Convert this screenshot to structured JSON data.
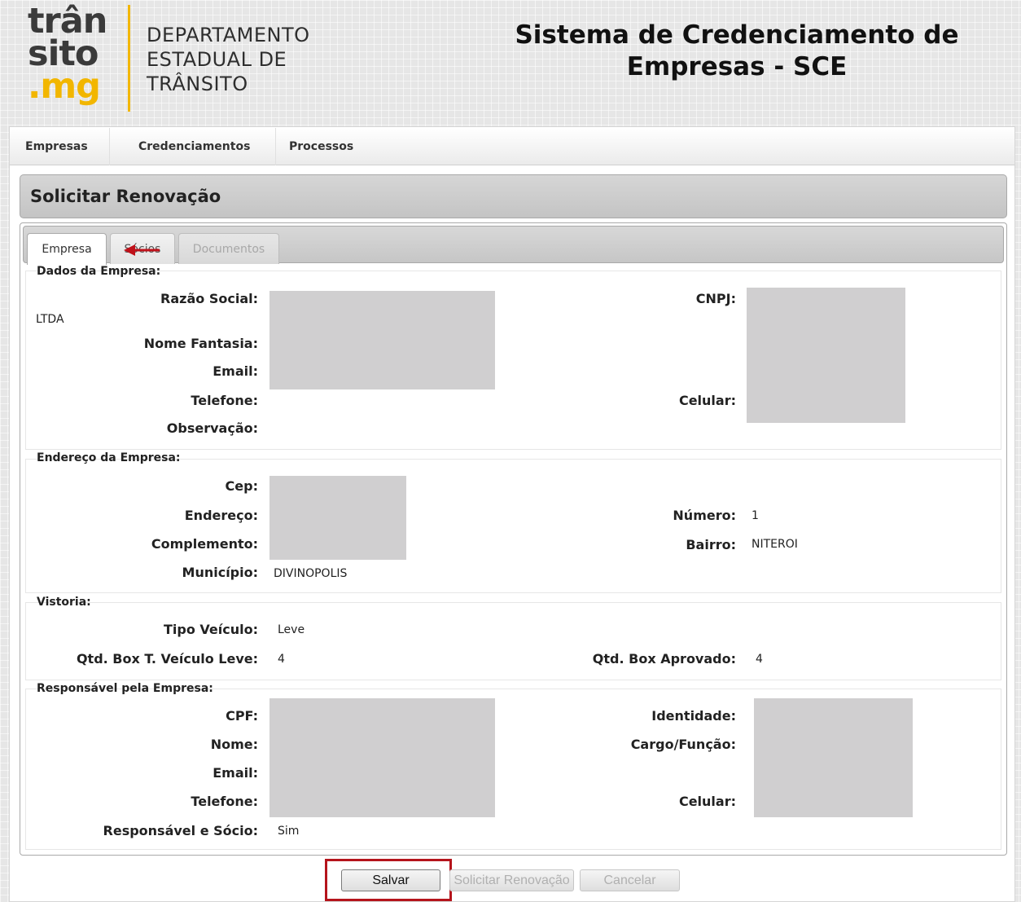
{
  "header": {
    "logo": {
      "line1": "trân",
      "line2": "sito",
      "line3": ".mg"
    },
    "department": [
      "DEPARTAMENTO",
      "ESTADUAL DE",
      "TRÂNSITO"
    ],
    "system_title": [
      "Sistema de Credenciamento de",
      "Empresas - SCE"
    ]
  },
  "menu": {
    "items": [
      "Empresas",
      "Credenciamentos",
      "Processos"
    ]
  },
  "page": {
    "title": "Solicitar Renovação",
    "tabs": [
      "Empresa",
      "Sócios",
      "Documentos"
    ]
  },
  "dados_empresa": {
    "title": "Dados da Empresa:",
    "labels": {
      "razao_social": "Razão Social:",
      "nome_fantasia": "Nome Fantasia:",
      "email": "Email:",
      "telefone": "Telefone:",
      "observacao": "Observação:",
      "cnpj": "CNPJ:",
      "celular": "Celular:"
    },
    "values": {
      "razao_social_suffix": "LTDA"
    }
  },
  "endereco": {
    "title": "Endereço da Empresa:",
    "labels": {
      "cep": "Cep:",
      "endereco": "Endereço:",
      "complemento": "Complemento:",
      "municipio": "Município:",
      "numero": "Número:",
      "bairro": "Bairro:"
    },
    "values": {
      "municipio": "DIVINOPOLIS",
      "numero": "1",
      "bairro": "NITEROI"
    }
  },
  "vistoria": {
    "title": "Vistoria:",
    "labels": {
      "tipo_veiculo": "Tipo Veículo:",
      "qtd_box_leve": "Qtd. Box T. Veículo Leve:",
      "qtd_box_aprovado": "Qtd. Box Aprovado:"
    },
    "values": {
      "tipo_veiculo": "Leve",
      "qtd_box_leve": "4",
      "qtd_box_aprovado": "4"
    }
  },
  "responsavel": {
    "title": "Responsável pela Empresa:",
    "labels": {
      "cpf": "CPF:",
      "nome": "Nome:",
      "email": "Email:",
      "telefone": "Telefone:",
      "responsavel_socio": "Responsável e Sócio:",
      "identidade": "Identidade:",
      "cargo": "Cargo/Função:",
      "celular": "Celular:"
    },
    "values": {
      "responsavel_socio": "Sim"
    }
  },
  "buttons": {
    "salvar": "Salvar",
    "solicitar": "Solicitar Renovação",
    "cancelar": "Cancelar"
  },
  "colors": {
    "accent_yellow": "#f2b600",
    "highlight_red": "#b5141c",
    "redaction_gray": "#d0cfd0"
  }
}
